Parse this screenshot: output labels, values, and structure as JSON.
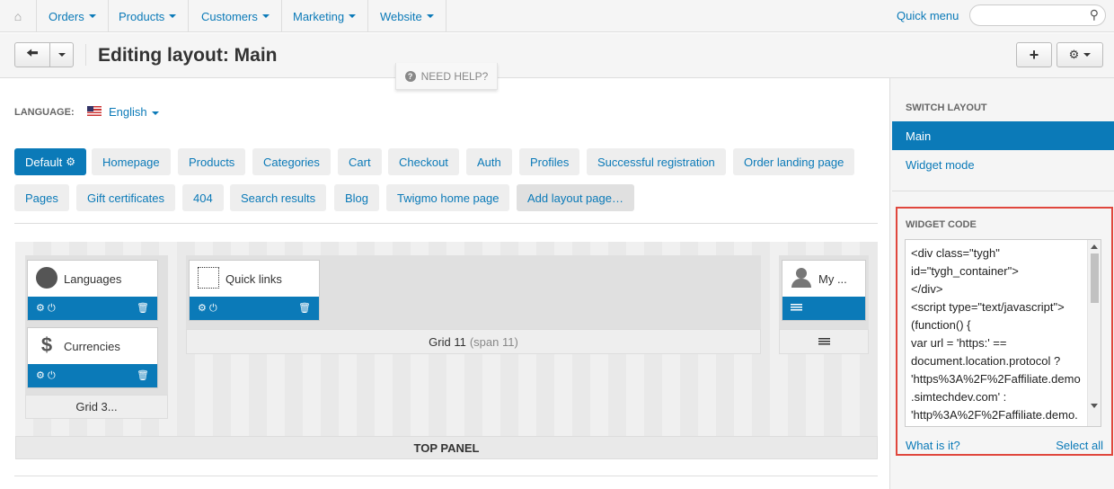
{
  "topnav": {
    "home_icon": "home-icon",
    "menus": [
      {
        "label": "Orders"
      },
      {
        "label": "Products"
      },
      {
        "label": "Customers"
      },
      {
        "label": "Marketing"
      },
      {
        "label": "Website"
      }
    ],
    "quick_menu": "Quick menu",
    "search": {
      "placeholder": "",
      "value": "",
      "icon": "search-icon"
    }
  },
  "header": {
    "title": "Editing layout: Main",
    "need_help": "NEED HELP?"
  },
  "language": {
    "label": "LANGUAGE:",
    "value": "English",
    "flag_icon": "us-flag-icon"
  },
  "layout_tabs": {
    "row1": [
      "Default",
      "Homepage",
      "Products",
      "Categories",
      "Cart",
      "Checkout",
      "Auth",
      "Profiles",
      "Successful registration",
      "Order landing page"
    ],
    "row2": [
      "Pages",
      "Gift certificates",
      "404",
      "Search results",
      "Blog",
      "Twigmo home page",
      "Add layout page…"
    ],
    "active": "Default"
  },
  "layout_editor": {
    "grid3": {
      "label": "Grid 3..."
    },
    "grid11": {
      "label": "Grid 11",
      "span": "(span 11)"
    },
    "grid_right": {
      "icon": "lines-icon"
    },
    "blocks": {
      "languages": "Languages",
      "currencies": "Currencies",
      "quick_links": "Quick links",
      "my_account": "My ..."
    },
    "top_panel": "TOP PANEL"
  },
  "sidebar": {
    "switch_layout_heading": "SWITCH LAYOUT",
    "items": [
      {
        "label": "Main"
      },
      {
        "label": "Widget mode"
      }
    ],
    "widget_code_heading": "WIDGET CODE",
    "widget_code_lines": [
      "<div class=\"tygh\"",
      "id=\"tygh_container\">",
      "</div>",
      "<script type=\"text/javascript\">",
      "(function() {",
      "var url = 'https:' ==",
      "document.location.protocol ?",
      "'https%3A%2F%2Faffiliate.demo",
      ".simtechdev.com' :",
      "'http%3A%2F%2Faffiliate.demo."
    ],
    "what_is_it": "What is it?",
    "select_all": "Select all"
  },
  "colors": {
    "accent": "#0b7ab8",
    "highlight_border": "#e0473d"
  }
}
